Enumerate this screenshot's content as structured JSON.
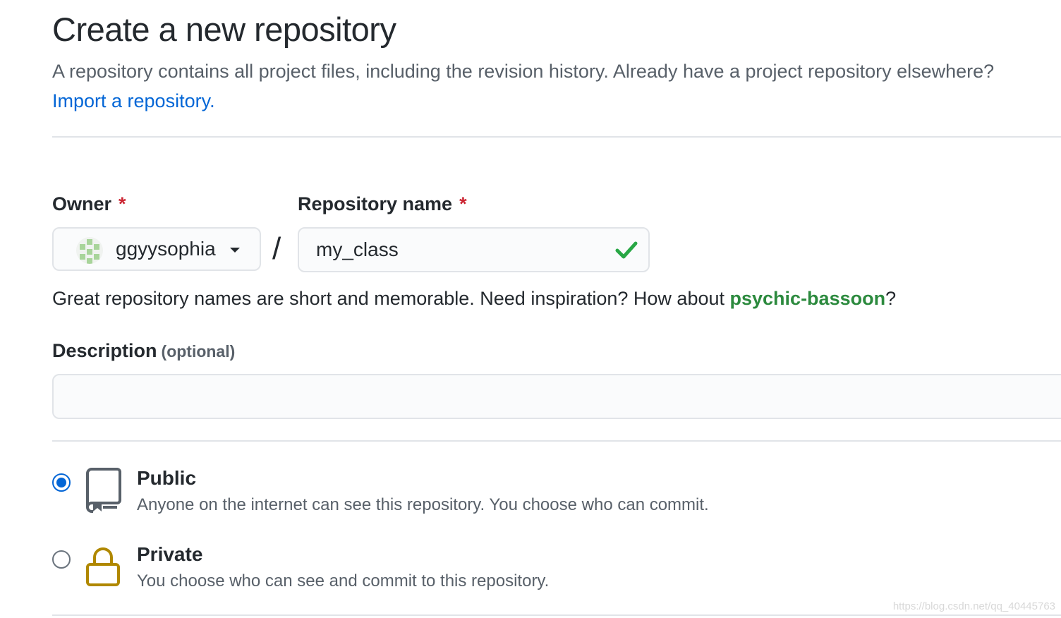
{
  "header": {
    "title": "Create a new repository",
    "subtitle_text": "A repository contains all project files, including the revision history. Already have a project repository elsewhere?",
    "import_link": "Import a repository."
  },
  "owner": {
    "label": "Owner",
    "required_mark": "*",
    "selected": "ggyysophia",
    "avatar_icon": "identicon-avatar"
  },
  "separator": "/",
  "repo_name": {
    "label": "Repository name",
    "required_mark": "*",
    "value": "my_class",
    "status_icon": "check-icon",
    "status_color": "#28a745"
  },
  "hint": {
    "text": "Great repository names are short and memorable. Need inspiration? How about",
    "suggestion": "psychic-bassoon",
    "suffix": "?"
  },
  "description": {
    "label": "Description",
    "optional": "(optional)",
    "value": ""
  },
  "visibility": {
    "options": [
      {
        "title": "Public",
        "description": "Anyone on the internet can see this repository. You choose who can commit.",
        "icon": "repo-icon",
        "checked": true
      },
      {
        "title": "Private",
        "description": "You choose who can see and commit to this repository.",
        "icon": "lock-icon",
        "checked": false
      }
    ]
  },
  "watermark": "https://blog.csdn.net/qq_40445763",
  "colors": {
    "link": "#0366d6",
    "required": "#cb2431",
    "suggestion": "#2c8a3e",
    "lock": "#b08800",
    "radio_checked": "#0366d6"
  }
}
